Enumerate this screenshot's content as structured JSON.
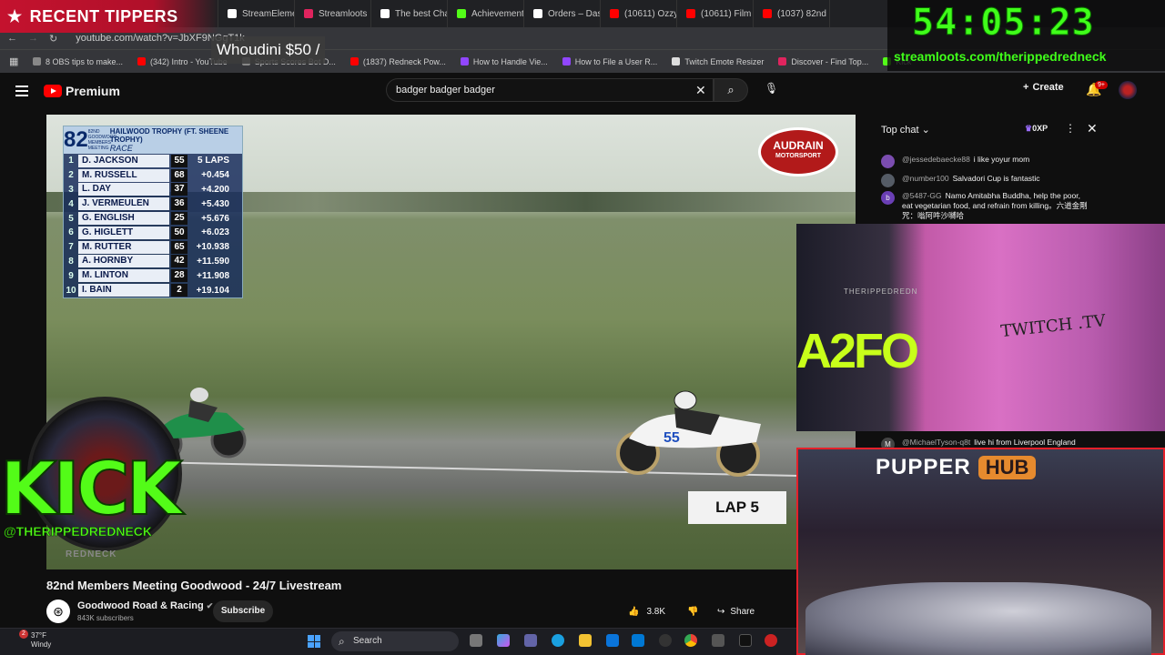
{
  "browser": {
    "tabs": [
      {
        "label": "StreamElements",
        "color": "#3b3b3b"
      },
      {
        "label": "StreamElements -",
        "color": "#ffffff"
      },
      {
        "label": "Streamloots | The",
        "color": "#e0245e"
      },
      {
        "label": "The best ChatBot",
        "color": "#ffffff"
      },
      {
        "label": "Achievements - K",
        "color": "#53fc18"
      },
      {
        "label": "Orders – Dashboa",
        "color": "#ffffff"
      },
      {
        "label": "(10611) Ozzy Osb",
        "color": "#ff0000"
      },
      {
        "label": "(10611) Film Musi",
        "color": "#ff0000"
      },
      {
        "label": "(1037) 82nd",
        "color": "#ff0000"
      }
    ],
    "url": "youtube.com/watch?v=JbXF9NGgT1k",
    "bookmarks": [
      {
        "label": "8 OBS tips to make...",
        "color": "#888888"
      },
      {
        "label": "(342) Intro - YouTube",
        "color": "#ff0000"
      },
      {
        "label": "Sports Scores Bot D...",
        "color": "#888888"
      },
      {
        "label": "(1837) Redneck Pow...",
        "color": "#ff0000"
      },
      {
        "label": "How to Handle Vie...",
        "color": "#9146ff"
      },
      {
        "label": "How to File a User R...",
        "color": "#9146ff"
      },
      {
        "label": "Twitch Emote Resizer",
        "color": "#dddddd"
      },
      {
        "label": "Discover - Find Top...",
        "color": "#e0245e"
      },
      {
        "label": "Kick",
        "color": "#53fc18"
      }
    ]
  },
  "youtube": {
    "logo": "Premium",
    "search_query": "badger badger badger",
    "create_label": "Create",
    "notif_badge": "9+",
    "video_title": "82nd Members Meeting Goodwood - 24/7 Livestream",
    "channel_name": "Goodwood Road & Racing",
    "channel_subs": "843K subscribers",
    "subscribe_label": "Subscribe",
    "likes": "3.8K",
    "share_label": "Share"
  },
  "video": {
    "scoreboard": {
      "number": "82",
      "meeting": "82ND GOODWOOD MEMBERS' MEETING",
      "title": "HAILWOOD TROPHY (FT. SHEENE TROPHY)",
      "subtitle": "RACE",
      "rows": [
        {
          "pos": "1",
          "name": "D. JACKSON",
          "car": "55",
          "gap": "5 LAPS"
        },
        {
          "pos": "2",
          "name": "M. RUSSELL",
          "car": "68",
          "gap": "+0.454"
        },
        {
          "pos": "3",
          "name": "L. DAY",
          "car": "37",
          "gap": "+4.200"
        },
        {
          "pos": "4",
          "name": "J. VERMEULEN",
          "car": "36",
          "gap": "+5.430"
        },
        {
          "pos": "5",
          "name": "G. ENGLISH",
          "car": "25",
          "gap": "+5.676"
        },
        {
          "pos": "6",
          "name": "G. HIGLETT",
          "car": "50",
          "gap": "+6.023"
        },
        {
          "pos": "7",
          "name": "M. RUTTER",
          "car": "65",
          "gap": "+10.938"
        },
        {
          "pos": "8",
          "name": "A. HORNBY",
          "car": "42",
          "gap": "+11.590"
        },
        {
          "pos": "9",
          "name": "M. LINTON",
          "car": "28",
          "gap": "+11.908"
        },
        {
          "pos": "10",
          "name": "I. BAIN",
          "car": "2",
          "gap": "+19.104"
        }
      ]
    },
    "sponsor_line1": "AUDRAIN",
    "sponsor_line2": "MOTORSPORT",
    "lap_label": "LAP 5",
    "bike_number": "55"
  },
  "chat": {
    "title": "Top chat",
    "xp": "0XP",
    "messages": [
      {
        "user": "@jessedebaecke88",
        "text": "i like yoyur mom",
        "color": "#7b4db0"
      },
      {
        "user": "@number100",
        "text": "Salvadori Cup is fantastic",
        "color": "#555c66"
      },
      {
        "user": "@5487-GG",
        "text": "Namo Amitabha Buddha, help the poor, eat vegetarian food, and refrain from killing。六道金剛咒：嗡阿吽沙嚩哈",
        "color": "#6a3fb5",
        "initial": "b"
      },
      {
        "user": "@MichaelTyson-q8t",
        "text": "live hi from Liverpool England",
        "color": "#444444",
        "initial": "M"
      }
    ]
  },
  "overlays": {
    "recent_tippers": "RECENT TIPPERS",
    "tipper": "Whoudini $50 /",
    "timer": "54:05:23",
    "timer_url": "streamloots.com/therippedredneck",
    "kick_word": "KICK",
    "kick_handle": "@THERIPPEDREDNECK",
    "kick_sub": "REDNECK",
    "cam_sign": "TWITCH .TV",
    "cam_neon": "A2FO",
    "cam_banner": "THERIPPEDREDN",
    "hub_pupper": "PUPPER",
    "hub_hub": "HUB"
  },
  "taskbar": {
    "weather_temp": "37°F",
    "weather_cond": "Windy",
    "weather_badge": "2",
    "search_label": "Search"
  }
}
